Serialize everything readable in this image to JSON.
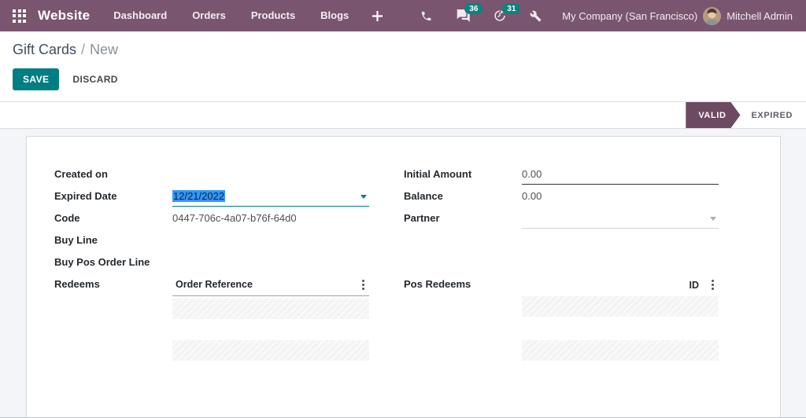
{
  "navbar": {
    "app": "Website",
    "menu": [
      "Dashboard",
      "Orders",
      "Products",
      "Blogs"
    ],
    "badges": {
      "messages": "36",
      "activities": "31"
    },
    "company": "My Company (San Francisco)",
    "user": "Mitchell Admin"
  },
  "breadcrumb": {
    "parent": "Gift Cards",
    "sep": "/",
    "current": "New"
  },
  "buttons": {
    "save": "SAVE",
    "discard": "DISCARD"
  },
  "statusbar": {
    "valid": "VALID",
    "expired": "EXPIRED"
  },
  "form": {
    "created_on": {
      "label": "Created on",
      "value": ""
    },
    "expired_date": {
      "label": "Expired Date",
      "value": "12/21/2022"
    },
    "code": {
      "label": "Code",
      "value": "0447-706c-4a07-b76f-64d0"
    },
    "buy_line": {
      "label": "Buy Line",
      "value": ""
    },
    "buy_pos_order_line": {
      "label": "Buy Pos Order Line",
      "value": ""
    },
    "redeems": {
      "label": "Redeems",
      "column_header": "Order Reference"
    },
    "initial_amount": {
      "label": "Initial Amount",
      "value": "0.00"
    },
    "balance": {
      "label": "Balance",
      "value": "0.00"
    },
    "partner": {
      "label": "Partner",
      "value": ""
    },
    "pos_redeems": {
      "label": "Pos Redeems",
      "column_header": "ID"
    }
  },
  "colors": {
    "navbar_bg": "#7a556f",
    "accent_teal": "#017e84",
    "badge_teal": "#0b837f",
    "status_active_bg": "#6e4a62",
    "selection_bg": "#3297fd",
    "content_bg": "#f4f5f8"
  }
}
